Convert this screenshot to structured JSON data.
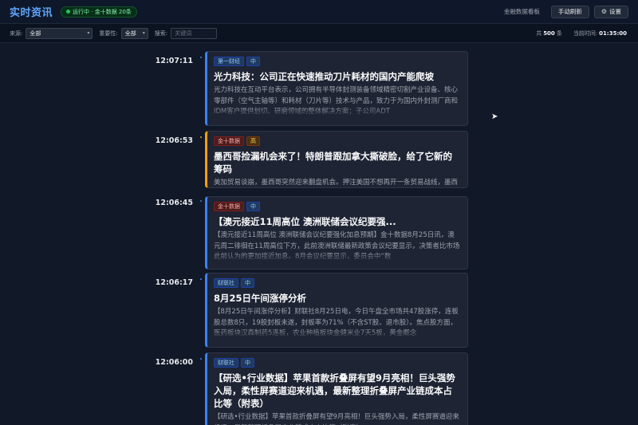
{
  "header": {
    "title": "实时资讯",
    "status": "运行中 · 金十数据 20条",
    "link": "金融数据看板",
    "manual_refresh": "手动刷新",
    "settings": "设置"
  },
  "filters": {
    "source_label": "来源:",
    "source_value": "全部",
    "importance_label": "重要性:",
    "importance_value": "全部",
    "search_label": "搜索:",
    "search_placeholder": "关键词",
    "total_prefix": "共",
    "total_count": "500",
    "total_suffix": "条",
    "time_label": "当前时间:",
    "time_value": "01:35:00"
  },
  "colors": {
    "accent": "#3b82f6",
    "warning": "#f59e0b"
  },
  "news": [
    {
      "time": "12:07:11",
      "tags": [
        {
          "text": "第一财经",
          "style": "blue"
        },
        {
          "text": "中",
          "style": "blue"
        }
      ],
      "title": "光力科技：公司正在快速推动刀片耗材的国内产能爬坡",
      "body": "光力科技在互动平台表示，公司拥有半导体封测装备领域精密切割产业设备、核心零部件（空气主轴等）和耗材（刀片等）技术与产品，致力于为国内外封测厂商和IDM客户提供划切、研磨领域的整体解决方案；子公司ADT"
    },
    {
      "time": "12:06:53",
      "tags": [
        {
          "text": "金十数据",
          "style": "red"
        },
        {
          "text": "高",
          "style": "amber"
        }
      ],
      "title": "墨西哥捡漏机会来了！特朗普跟加拿大撕破脸，给了它新的筹码",
      "body": "美加贸易谈崩，墨西哥突然迎来翻盘机会。押注美国不想再开一条贸易战线，墨西哥赶上卓加码谈判。"
    },
    {
      "time": "12:06:45",
      "tags": [
        {
          "text": "金十数据",
          "style": "red"
        },
        {
          "text": "中",
          "style": "blue"
        }
      ],
      "title": "【澳元接近11周高位 澳洲联储会议纪要强...",
      "body": "【澳元接近11周高位 澳洲联储会议纪要强化加息预期】金十数据8月25日讯，澳元周二徘徊在11周高位下方，此前澳洲联储最新政策会议纪要显示，决策者比市场此前认为的更加接近加息。8月会议纪要显示，委员会中“数"
    },
    {
      "time": "12:06:17",
      "tags": [
        {
          "text": "财联社",
          "style": "blue"
        },
        {
          "text": "中",
          "style": "blue"
        }
      ],
      "title": "8月25日午间涨停分析",
      "body": "【8月25日午间涨停分析】财联社8月25日电，今日午盘全市场共47股涨停，连板股总数8只，19股封板未遂，封板率为71%（不含ST股、退市股）。焦点股方面，医药板块汉森制药5连板，农业种植板块金健米业7天5板，黄金概念"
    },
    {
      "time": "12:06:00",
      "tags": [
        {
          "text": "财联社",
          "style": "blue"
        },
        {
          "text": "中",
          "style": "blue"
        }
      ],
      "title": "【研选•行业数据】苹果首款折叠屏有望9月亮相！巨头强势入局，柔性屏赛道迎来机遇，最新整理折叠屏产业链成本占比等（附表）",
      "body": "【研选•行业数据】苹果首款折叠屏有望9月亮相！巨头强势入局，柔性屏赛道迎来机遇，最新整理折叠屏产业链成本占比等（附表）"
    }
  ]
}
